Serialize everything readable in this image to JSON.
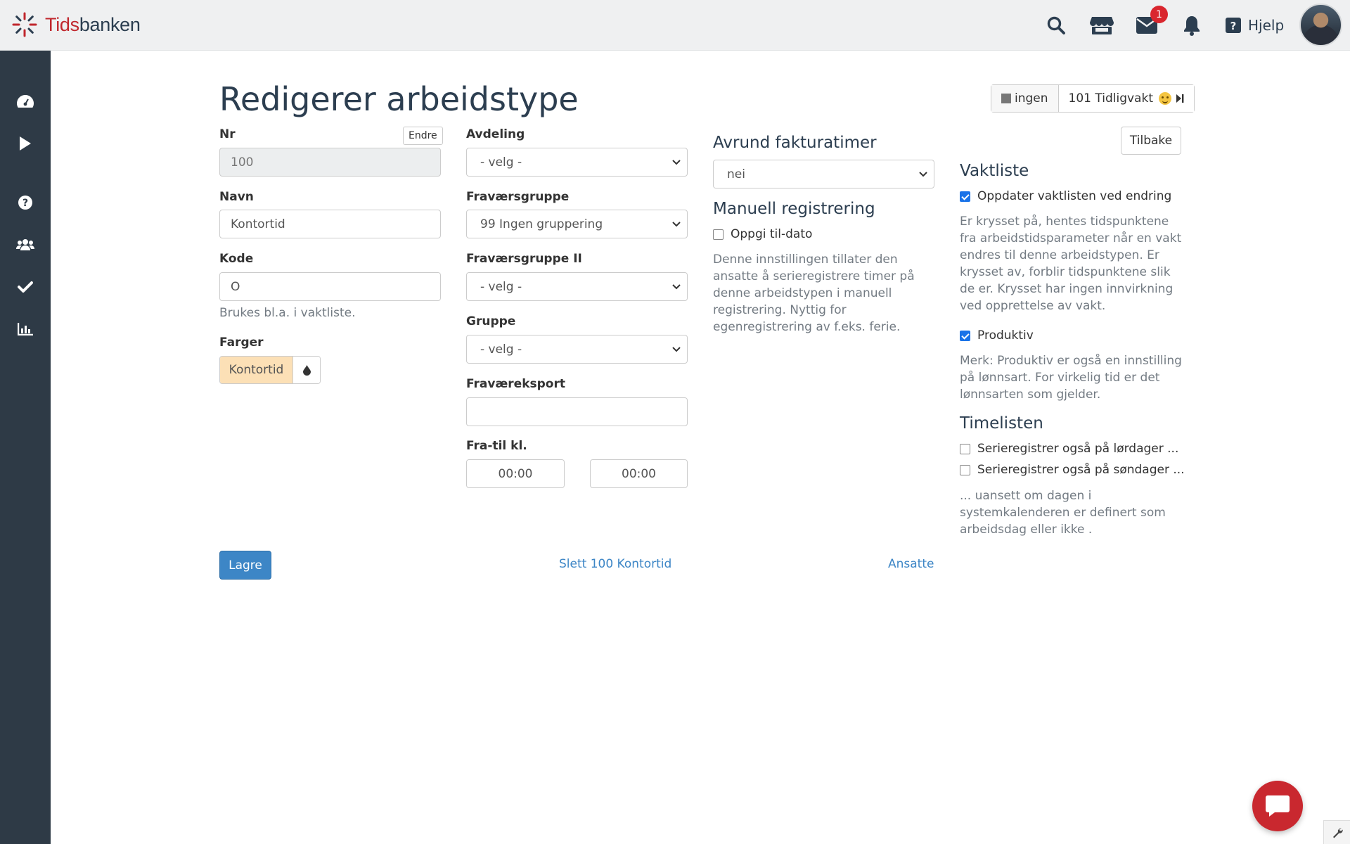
{
  "app": {
    "logo_prefix": "Tids",
    "logo_suffix": "banken",
    "brand_color": "#c0272d",
    "sidebar_color": "#2e3a46"
  },
  "topbar": {
    "icons": [
      "search-icon",
      "store-icon",
      "mail-icon",
      "bell-icon"
    ],
    "mail_badge": "1",
    "help_label": "Hjelp"
  },
  "sidebar": {
    "items": [
      "dashboard-icon",
      "play-icon",
      "help-circle-icon",
      "users-icon",
      "check-icon",
      "chart-icon"
    ]
  },
  "page": {
    "title": "Redigerer arbeidstype",
    "shift_none_label": "ingen",
    "shift_next_label": "101 Tidligvakt",
    "back_label": "Tilbake"
  },
  "form": {
    "nr_label": "Nr",
    "nr_value": "100",
    "endre_label": "Endre",
    "navn_label": "Navn",
    "navn_value": "Kontortid",
    "kode_label": "Kode",
    "kode_value": "O",
    "kode_help": "Brukes bl.a. i vaktliste.",
    "farger_label": "Farger",
    "farger_value": "Kontortid",
    "farger_color": "#fce0b6",
    "avdeling_label": "Avdeling",
    "avdeling_value": "- velg -",
    "fravaersgruppe_label": "Fraværsgruppe",
    "fravaersgruppe_value": "99 Ingen gruppering",
    "fravaersgruppe2_label": "Fraværsgruppe II",
    "fravaersgruppe2_value": "- velg -",
    "gruppe_label": "Gruppe",
    "gruppe_value": "- velg -",
    "fravaereksport_label": "Fraværeksport",
    "fravaereksport_value": "",
    "fratil_label": "Fra-til kl.",
    "fra_value": "00:00",
    "til_value": "00:00",
    "avrund_heading": "Avrund fakturatimer",
    "avrund_value": "nei",
    "manuell_heading": "Manuell registrering",
    "oppgi_label": "Oppgi til-dato",
    "oppgi_checked": false,
    "manuell_help": "Denne innstillingen tillater den ansatte å serieregistrere timer på denne arbeidstypen i manuell registrering. Nyttig for egenregistrering av f.eks. ferie."
  },
  "vaktliste": {
    "heading": "Vaktliste",
    "oppdater_label": "Oppdater vaktlisten ved endring",
    "oppdater_checked": true,
    "oppdater_help": "Er krysset på, hentes tidspunktene fra arbeidstidsparameter når en vakt endres til denne arbeidstypen. Er krysset av, forblir tidspunktene slik de er. Krysset har ingen innvirkning ved opprettelse av vakt.",
    "produktiv_label": "Produktiv",
    "produktiv_checked": true,
    "produktiv_help": "Merk: Produktiv er også en innstilling på lønnsart. For virkelig tid er det lønnsarten som gjelder."
  },
  "timelisten": {
    "heading": "Timelisten",
    "lordag_label": "Serieregistrer også på lørdager ...",
    "lordag_checked": false,
    "sondag_label": "Serieregistrer også på søndager ...",
    "sondag_checked": false,
    "help": "... uansett om dagen i systemkalenderen er definert som arbeidsdag eller ikke ."
  },
  "actions": {
    "save_label": "Lagre",
    "delete_label": "Slett 100 Kontortid",
    "ansatte_label": "Ansatte"
  }
}
